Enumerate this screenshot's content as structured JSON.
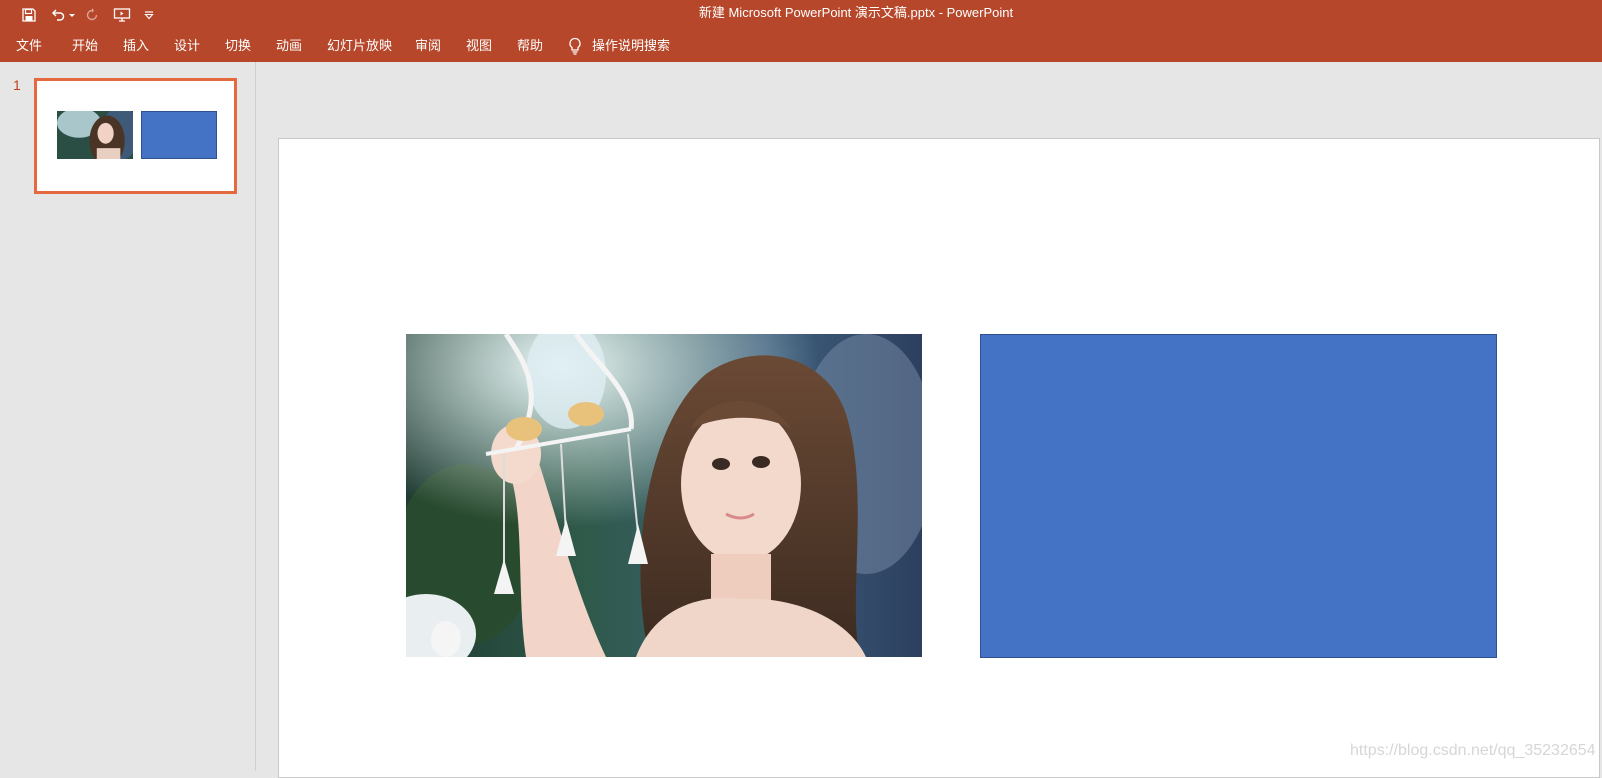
{
  "app": {
    "window_title": "新建 Microsoft PowerPoint 演示文稿.pptx  -  PowerPoint",
    "accent": "#b7472a"
  },
  "quick_access": {
    "icons": [
      "save-icon",
      "undo-icon",
      "undo-dropdown-icon",
      "redo-icon",
      "present-from-beginning-icon",
      "customize-qat-icon"
    ]
  },
  "ribbon": {
    "tabs": [
      {
        "label": "文件"
      },
      {
        "label": "开始"
      },
      {
        "label": "插入"
      },
      {
        "label": "设计"
      },
      {
        "label": "切换"
      },
      {
        "label": "动画"
      },
      {
        "label": "幻灯片放映"
      },
      {
        "label": "审阅"
      },
      {
        "label": "视图"
      },
      {
        "label": "帮助"
      }
    ],
    "tell_me": {
      "icon": "lightbulb-icon",
      "label": "操作说明搜索"
    }
  },
  "thumbnails": {
    "selected_border": "#e4693f",
    "slides": [
      {
        "number": "1"
      }
    ]
  },
  "slide": {
    "shape_fill": "#4472c4",
    "shape_outline": "#2f528f"
  },
  "watermark": {
    "text": "https://blog.csdn.net/qq_35232654"
  }
}
